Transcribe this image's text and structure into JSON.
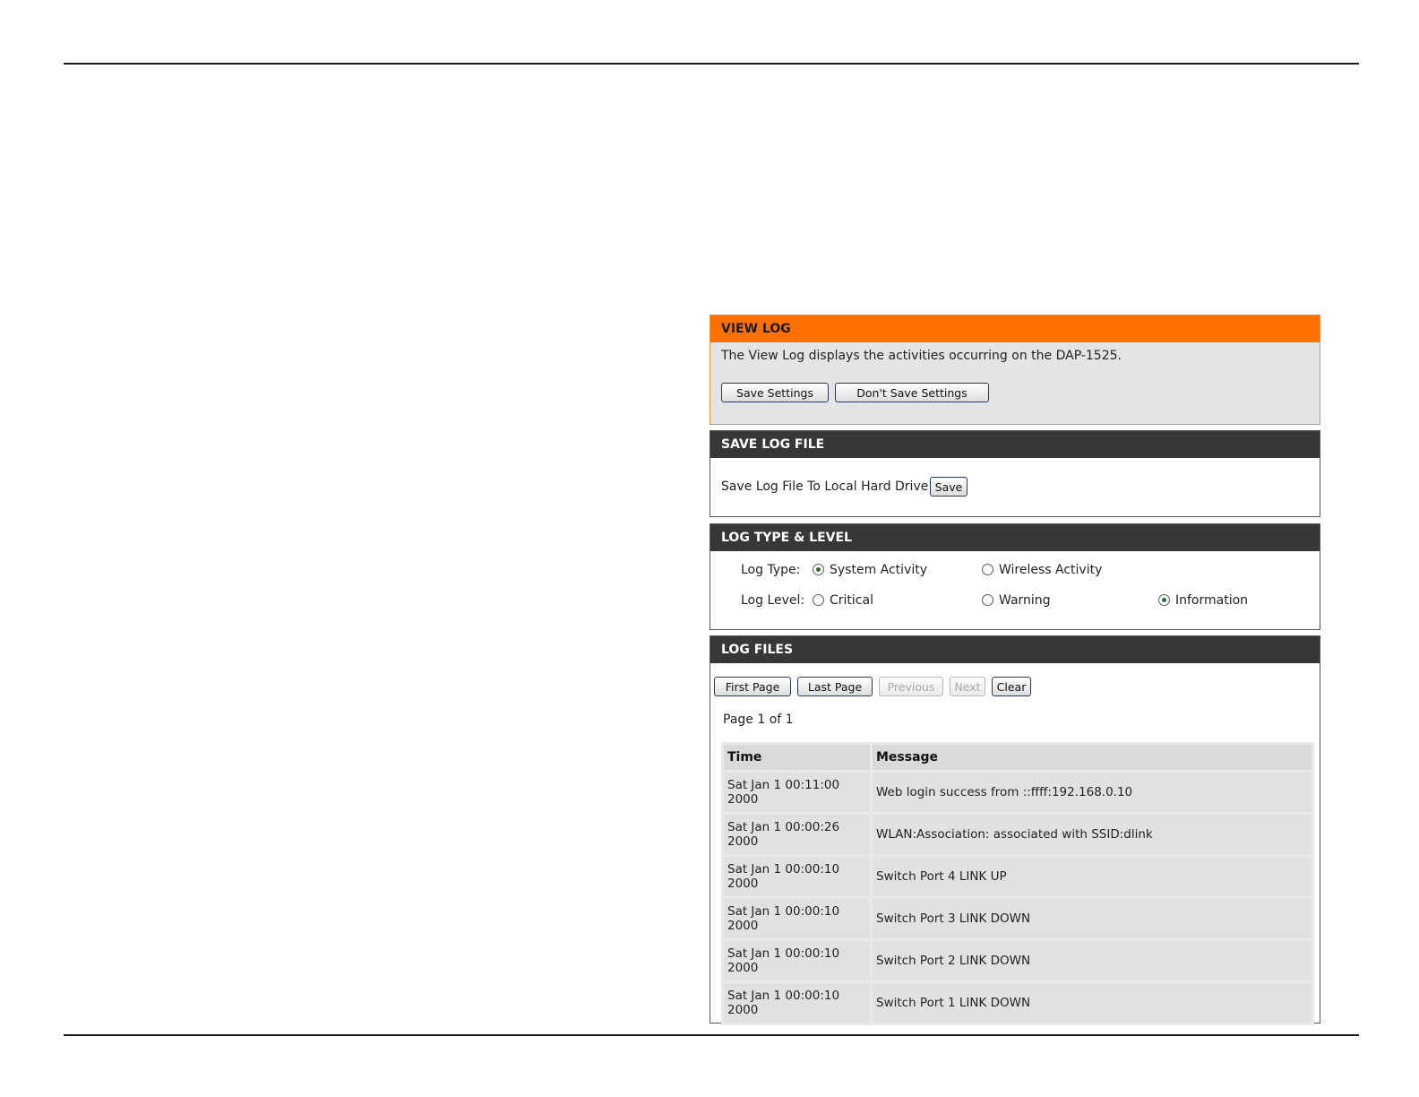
{
  "view_log": {
    "title": "VIEW LOG",
    "description": "The View Log displays the activities occurring on the DAP-1525.",
    "save_settings_label": "Save Settings",
    "dont_save_label": "Don't Save Settings"
  },
  "save_log_file": {
    "title": "SAVE LOG FILE",
    "text": "Save Log File To Local Hard Drive.",
    "save_label": "Save"
  },
  "log_type_level": {
    "title": "LOG TYPE & LEVEL",
    "log_type_label": "Log Type:",
    "log_level_label": "Log Level:",
    "types": [
      {
        "label": "System Activity",
        "checked": true
      },
      {
        "label": "Wireless Activity",
        "checked": false
      }
    ],
    "levels": [
      {
        "label": "Critical",
        "checked": false
      },
      {
        "label": "Warning",
        "checked": false
      },
      {
        "label": "Information",
        "checked": true
      }
    ]
  },
  "log_files": {
    "title": "LOG FILES",
    "first_page_label": "First Page",
    "last_page_label": "Last Page",
    "previous_label": "Previous",
    "next_label": "Next",
    "clear_label": "Clear",
    "page_info": "Page 1 of 1",
    "columns": [
      "Time",
      "Message"
    ],
    "rows": [
      {
        "time_line1": "Sat Jan 1 00:11:00",
        "time_line2": "2000",
        "message": "Web login success from ::ffff:192.168.0.10"
      },
      {
        "time_line1": "Sat Jan 1 00:00:26",
        "time_line2": "2000",
        "message": "WLAN:Association: associated with SSID:dlink"
      },
      {
        "time_line1": "Sat Jan 1 00:00:10",
        "time_line2": "2000",
        "message": "Switch Port 4 LINK UP"
      },
      {
        "time_line1": "Sat Jan 1 00:00:10",
        "time_line2": "2000",
        "message": "Switch Port 3 LINK DOWN"
      },
      {
        "time_line1": "Sat Jan 1 00:00:10",
        "time_line2": "2000",
        "message": "Switch Port 2 LINK DOWN"
      },
      {
        "time_line1": "Sat Jan 1 00:00:10",
        "time_line2": "2000",
        "message": "Switch Port 1 LINK DOWN"
      }
    ]
  }
}
